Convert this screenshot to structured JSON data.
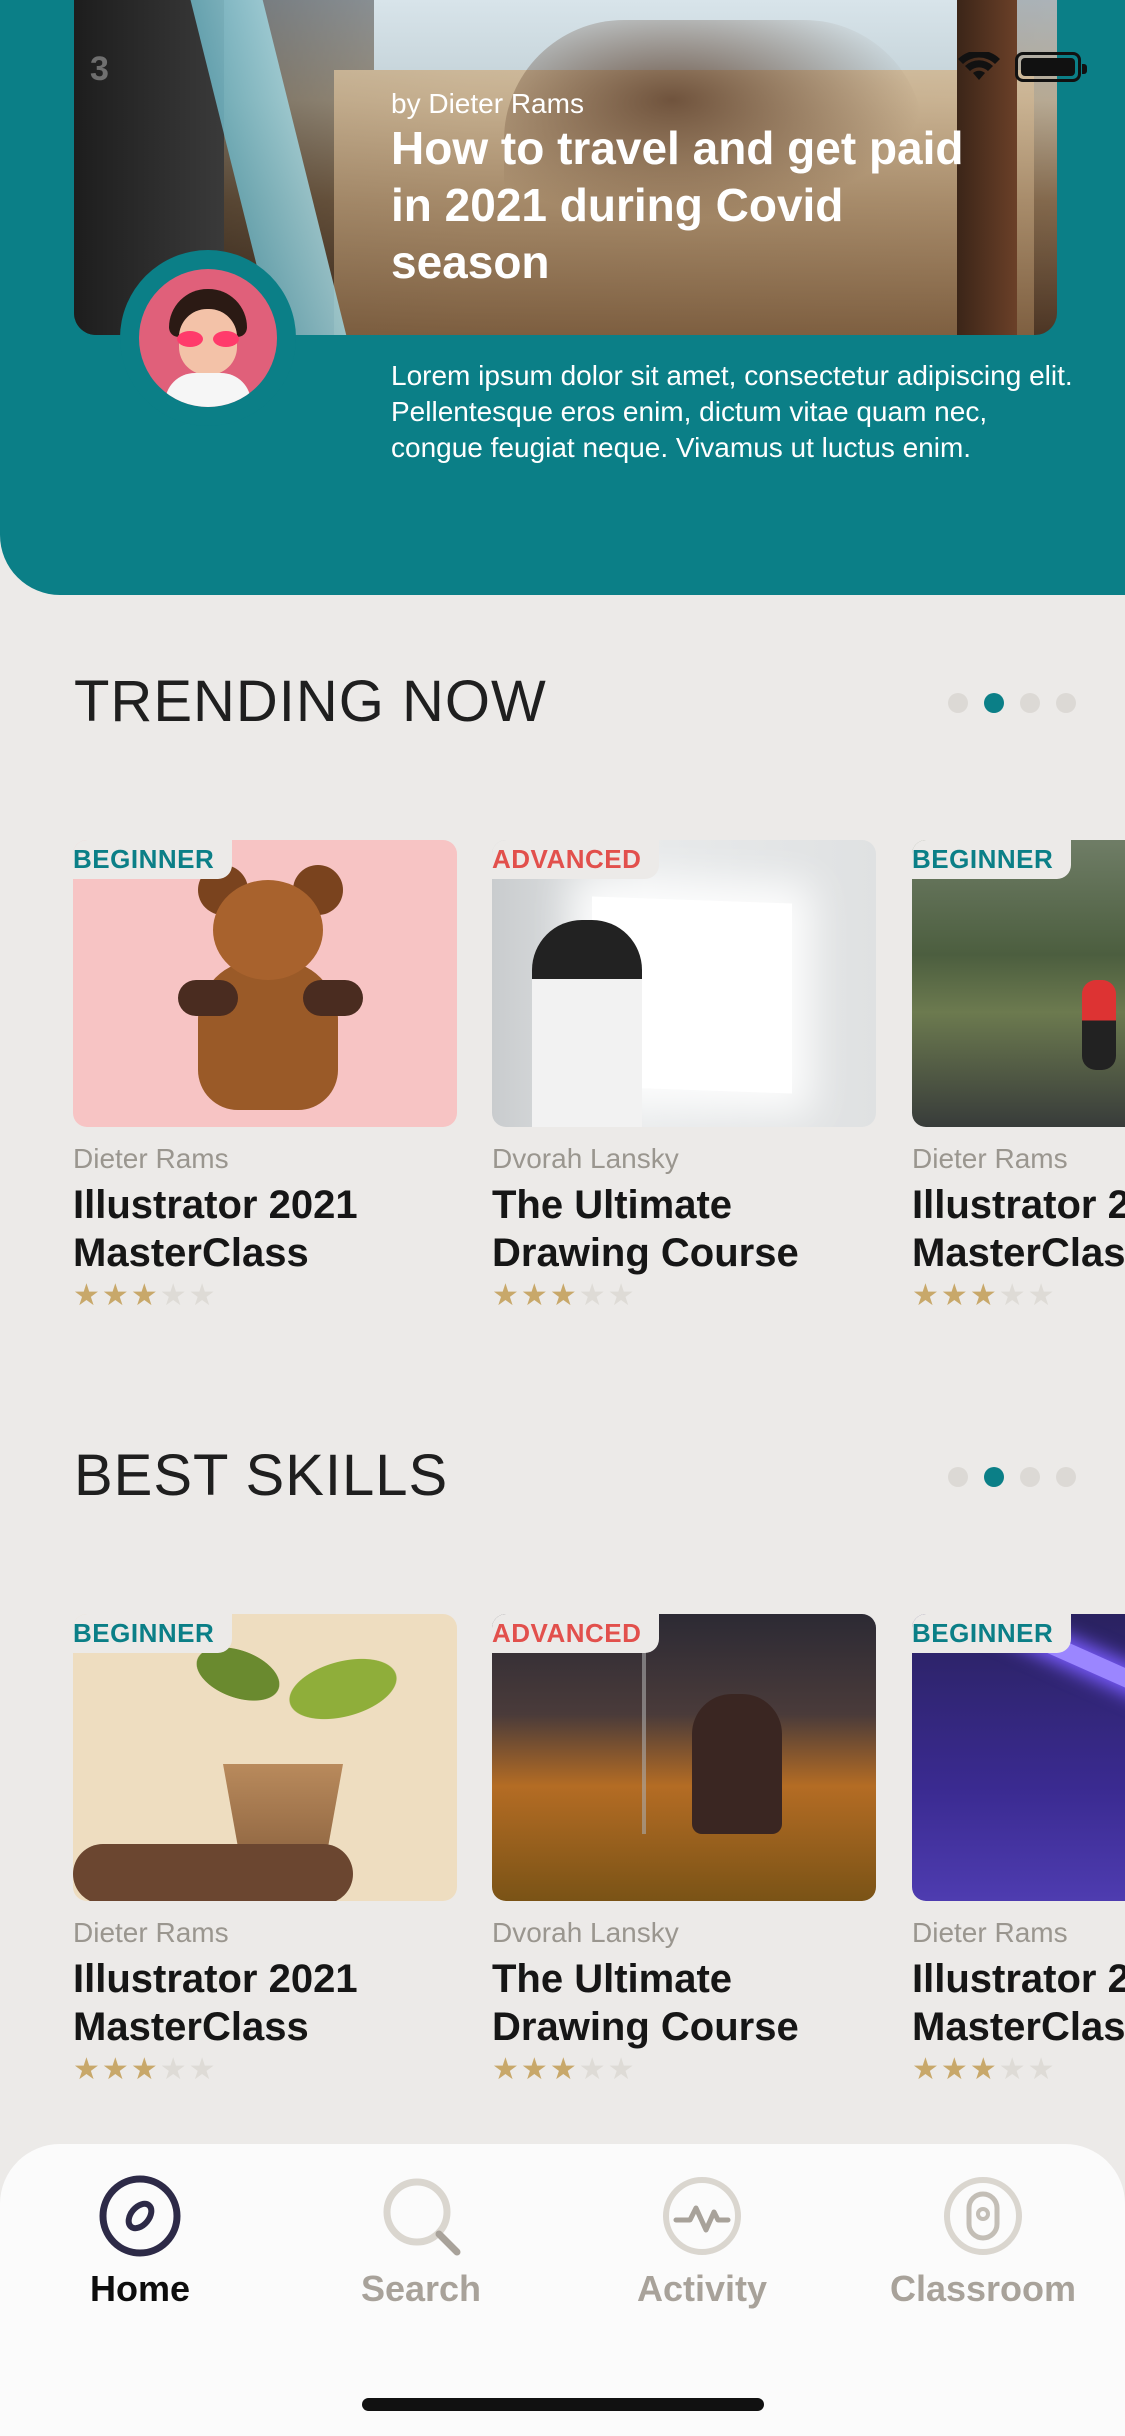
{
  "status_bar": {
    "time": "3"
  },
  "hero": {
    "author": "by Dieter Rams",
    "title": "How to travel and get paid in 2021 during Covid season",
    "description": "Lorem ipsum dolor sit amet, consectetur adipiscing elit. Pellentesque eros enim, dictum vitae quam nec, congue feugiat neque. Vivamus ut luctus enim.",
    "accent_color": "#0B7F87"
  },
  "sections": [
    {
      "title": "TRENDING NOW",
      "active_page": 2,
      "pages": 4,
      "cards": [
        {
          "level": "BEGINNER",
          "author": "Dieter Rams",
          "title_line1": "Illustrator 2021",
          "title_line2": "MasterClass",
          "rating": 3,
          "image": "teddy-bear"
        },
        {
          "level": "ADVANCED",
          "author": "Dvorah Lansky",
          "title_line1": "The Ultimate",
          "title_line2": "Drawing Course",
          "rating": 3,
          "image": "drawing-board"
        },
        {
          "level": "BEGINNER",
          "author": "Dieter Rams",
          "title_line1": "Illustrator 2",
          "title_line2": "MasterClas",
          "rating": 3,
          "image": "runner-road"
        }
      ]
    },
    {
      "title": "BEST SKILLS",
      "active_page": 2,
      "pages": 4,
      "cards": [
        {
          "level": "BEGINNER",
          "author": "Dieter Rams",
          "title_line1": "Illustrator 2021",
          "title_line2": "MasterClass",
          "rating": 3,
          "image": "potted-plant"
        },
        {
          "level": "ADVANCED",
          "author": "Dvorah Lansky",
          "title_line1": "The Ultimate",
          "title_line2": "Drawing Course",
          "rating": 3,
          "image": "field-sunset"
        },
        {
          "level": "BEGINNER",
          "author": "Dieter Rams",
          "title_line1": "Illustrator 2",
          "title_line2": "MasterClas",
          "rating": 3,
          "image": "neon-light"
        }
      ]
    }
  ],
  "tabbar": {
    "active": "Home",
    "tabs": [
      {
        "label": "Home",
        "icon": "compass-icon"
      },
      {
        "label": "Search",
        "icon": "search-icon"
      },
      {
        "label": "Activity",
        "icon": "activity-icon"
      },
      {
        "label": "Classroom",
        "icon": "classroom-icon"
      }
    ]
  },
  "colors": {
    "beginner": "#0B7F87",
    "advanced": "#E2504C",
    "star_on": "#C8A86A",
    "star_off": "#DEDBD6"
  }
}
